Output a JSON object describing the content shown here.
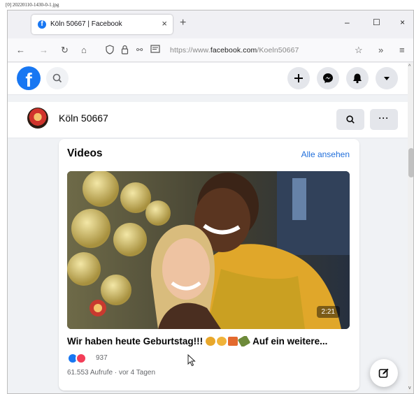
{
  "caption": "[0] 20220110-1430-0-1.jpg",
  "browser": {
    "tab_title": "Köln 50667 | Facebook",
    "tab_close": "×",
    "new_tab": "+",
    "window_controls": {
      "minimize": "–",
      "maximize": "☐",
      "close": "×"
    },
    "url_prefix": "https://www.",
    "url_domain": "facebook.com",
    "url_path": "/Koeln50667"
  },
  "facebook": {
    "logo_letter": "f",
    "page_name": "Köln 50667",
    "more_label": "···"
  },
  "videos_card": {
    "title": "Videos",
    "see_all": "Alle ansehen",
    "duration": "2:21",
    "video_title_start": "Wir haben heute Geburtstag!!!",
    "video_title_end": "Auf ein weitere...",
    "reaction_count": "937",
    "meta": "61.553 Aufrufe · vor 4 Tagen"
  },
  "colors": {
    "brand": "#1877f2",
    "link": "#216fdb",
    "like": "#1877f2",
    "love": "#f33e58"
  }
}
